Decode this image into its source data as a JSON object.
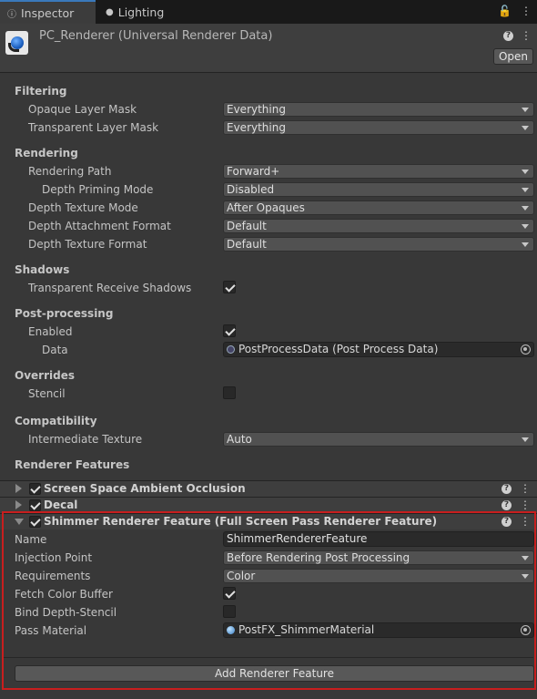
{
  "tabs": [
    {
      "label": "Inspector",
      "icon": "info-icon",
      "active": true
    },
    {
      "label": "Lighting",
      "icon": "bulb-icon",
      "active": false
    }
  ],
  "header": {
    "title": "PC_Renderer (Universal Renderer Data)",
    "open_label": "Open"
  },
  "filtering": {
    "heading": "Filtering",
    "opaque_label": "Opaque Layer Mask",
    "opaque_value": "Everything",
    "transparent_label": "Transparent Layer Mask",
    "transparent_value": "Everything"
  },
  "rendering": {
    "heading": "Rendering",
    "path_label": "Rendering Path",
    "path_value": "Forward+",
    "priming_label": "Depth Priming Mode",
    "priming_value": "Disabled",
    "texmode_label": "Depth Texture Mode",
    "texmode_value": "After Opaques",
    "attach_label": "Depth Attachment Format",
    "attach_value": "Default",
    "texfmt_label": "Depth Texture Format",
    "texfmt_value": "Default"
  },
  "shadows": {
    "heading": "Shadows",
    "receive_label": "Transparent Receive Shadows",
    "receive_checked": true
  },
  "postprocessing": {
    "heading": "Post-processing",
    "enabled_label": "Enabled",
    "enabled_checked": true,
    "data_label": "Data",
    "data_value": "PostProcessData (Post Process Data)"
  },
  "overrides": {
    "heading": "Overrides",
    "stencil_label": "Stencil",
    "stencil_checked": false
  },
  "compatibility": {
    "heading": "Compatibility",
    "intermediate_label": "Intermediate Texture",
    "intermediate_value": "Auto"
  },
  "features": {
    "heading": "Renderer Features",
    "items": [
      {
        "name": "Screen Space Ambient Occlusion",
        "expanded": false,
        "enabled": true
      },
      {
        "name": "Decal",
        "expanded": false,
        "enabled": true
      },
      {
        "name": "Shimmer Renderer Feature (Full Screen Pass Renderer Feature)",
        "expanded": true,
        "enabled": true
      }
    ],
    "shimmer": {
      "name_label": "Name",
      "name_value": "ShimmerRendererFeature",
      "injection_label": "Injection Point",
      "injection_value": "Before Rendering Post Processing",
      "requirements_label": "Requirements",
      "requirements_value": "Color",
      "fetch_label": "Fetch Color Buffer",
      "fetch_checked": true,
      "bind_label": "Bind Depth-Stencil",
      "bind_checked": false,
      "material_label": "Pass Material",
      "material_value": "PostFX_ShimmerMaterial"
    },
    "add_label": "Add Renderer Feature"
  },
  "colors": {
    "accent": "#3a79bb",
    "highlight_border": "#c81e1e"
  }
}
